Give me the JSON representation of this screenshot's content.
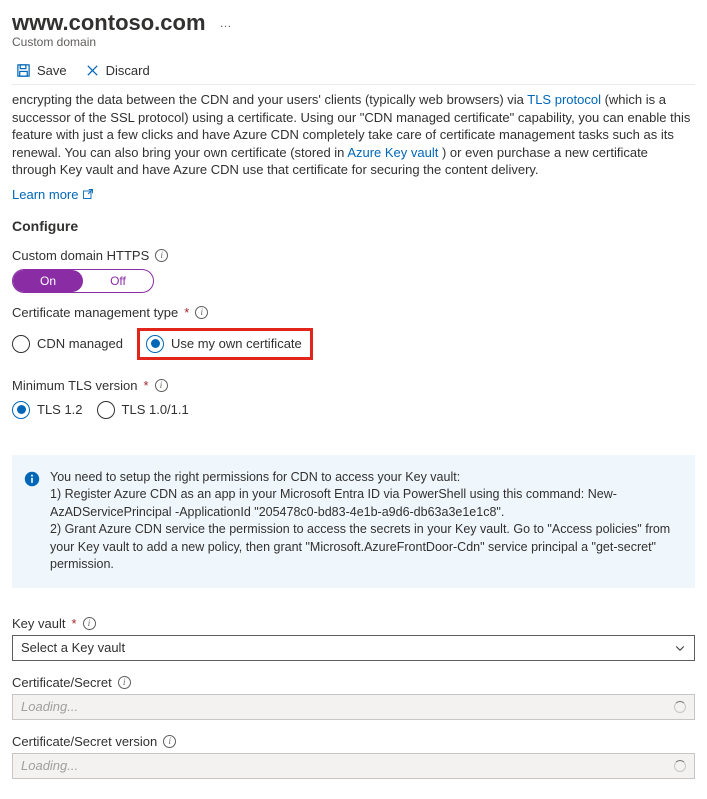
{
  "header": {
    "title": "www.contoso.com",
    "subtitle": "Custom domain"
  },
  "commands": {
    "save": "Save",
    "discard": "Discard"
  },
  "intro": {
    "line1_a": "encrypting the data between the CDN and your users' clients (typically web browsers) via ",
    "tls_link": "TLS protocol",
    "line1_b": " (which is a successor of the SSL protocol) using a certificate. Using our \"CDN managed certificate\" capability, you can enable this feature with just a few clicks and have Azure CDN completely take care of certificate management tasks such as its renewal. You can also bring your own certificate (stored in ",
    "akv_link": "Azure Key vault",
    "line1_c": " ) or even purchase a new certificate through Key vault and have Azure CDN use that certificate for securing the content delivery.",
    "learn_more": "Learn more"
  },
  "configure": {
    "heading": "Configure",
    "https_label": "Custom domain HTTPS",
    "toggle_on": "On",
    "toggle_off": "Off",
    "cert_label": "Certificate management type",
    "cert_cdn": "CDN managed",
    "cert_own": "Use my own certificate",
    "tls_label": "Minimum TLS version",
    "tls12": "TLS 1.2",
    "tls10": "TLS 1.0/1.1"
  },
  "infobox": {
    "l1": "You need to setup the right permissions for CDN to access your Key vault:",
    "l2": "1) Register Azure CDN as an app in your Microsoft Entra ID via PowerShell using this command: New-AzADServicePrincipal -ApplicationId \"205478c0-bd83-4e1b-a9d6-db63a3e1e1c8\".",
    "l3": "2) Grant Azure CDN service the permission to access the secrets in your Key vault. Go to \"Access policies\" from your Key vault to add a new policy, then grant \"Microsoft.AzureFrontDoor-Cdn\" service principal a \"get-secret\" permission."
  },
  "kv": {
    "label": "Key vault",
    "placeholder": "Select a Key vault",
    "cert_label": "Certificate/Secret",
    "ver_label": "Certificate/Secret version",
    "loading": "Loading..."
  }
}
